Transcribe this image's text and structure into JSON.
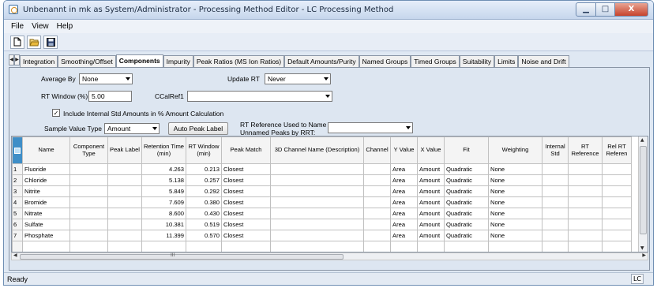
{
  "window": {
    "title": "Unbenannt in mk as System/Administrator - Processing Method Editor - LC Processing Method",
    "controls": {
      "minimize": "▁",
      "maximize": "□",
      "close": "X"
    }
  },
  "menu": [
    "File",
    "View",
    "Help"
  ],
  "toolbar": {
    "icons": [
      "new-icon",
      "open-icon",
      "save-icon"
    ]
  },
  "tabs": [
    {
      "label": "Integration",
      "active": false
    },
    {
      "label": "Smoothing/Offset",
      "active": false
    },
    {
      "label": "Components",
      "active": true
    },
    {
      "label": "Impurity",
      "active": false
    },
    {
      "label": "Peak Ratios (MS Ion Ratios)",
      "active": false
    },
    {
      "label": "Default Amounts/Purity",
      "active": false
    },
    {
      "label": "Named Groups",
      "active": false
    },
    {
      "label": "Timed Groups",
      "active": false
    },
    {
      "label": "Suitability",
      "active": false
    },
    {
      "label": "Limits",
      "active": false
    },
    {
      "label": "Noise and Drift",
      "active": false
    }
  ],
  "form": {
    "average_by_label": "Average By",
    "average_by_value": "None",
    "update_rt_label": "Update RT",
    "update_rt_value": "Never",
    "rt_window_label": "RT Window (%)",
    "rt_window_value": "5.00",
    "ccalref_label": "CCalRef1",
    "ccalref_value": "",
    "include_internal_label": "Include Internal Std Amounts in % Amount Calculation",
    "include_internal_checked": "✓",
    "sample_value_type_label": "Sample Value Type",
    "sample_value_type_value": "Amount",
    "auto_peak_label_button": "Auto Peak Label",
    "rt_reference_label_1": "RT Reference Used to Name",
    "rt_reference_label_2": "Unnamed Peaks by RRT:",
    "rt_reference_value": ""
  },
  "table": {
    "columns": [
      "Name",
      "Component Type",
      "Peak Label",
      "Retention Time (min)",
      "RT Window (min)",
      "Peak Match",
      "3D Channel Name (Description)",
      "Channel",
      "Y Value",
      "X Value",
      "Fit",
      "Weighting",
      "Internal Std",
      "RT Reference",
      "Rel RT Referen"
    ],
    "rows": [
      {
        "num": "1",
        "name": "Fluoride",
        "rt": "4.263",
        "rtw": "0.213",
        "match": "Closest",
        "y": "Area",
        "x": "Amount",
        "fit": "Quadratic",
        "weight": "None"
      },
      {
        "num": "2",
        "name": "Chloride",
        "rt": "5.138",
        "rtw": "0.257",
        "match": "Closest",
        "y": "Area",
        "x": "Amount",
        "fit": "Quadratic",
        "weight": "None"
      },
      {
        "num": "3",
        "name": "Nitrite",
        "rt": "5.849",
        "rtw": "0.292",
        "match": "Closest",
        "y": "Area",
        "x": "Amount",
        "fit": "Quadratic",
        "weight": "None"
      },
      {
        "num": "4",
        "name": "Bromide",
        "rt": "7.609",
        "rtw": "0.380",
        "match": "Closest",
        "y": "Area",
        "x": "Amount",
        "fit": "Quadratic",
        "weight": "None"
      },
      {
        "num": "5",
        "name": "Nitrate",
        "rt": "8.600",
        "rtw": "0.430",
        "match": "Closest",
        "y": "Area",
        "x": "Amount",
        "fit": "Quadratic",
        "weight": "None"
      },
      {
        "num": "6",
        "name": "Sulfate",
        "rt": "10.381",
        "rtw": "0.519",
        "match": "Closest",
        "y": "Area",
        "x": "Amount",
        "fit": "Quadratic",
        "weight": "None"
      },
      {
        "num": "7",
        "name": "Phosphate",
        "rt": "11.399",
        "rtw": "0.570",
        "match": "Closest",
        "y": "Area",
        "x": "Amount",
        "fit": "Quadratic",
        "weight": "None"
      }
    ]
  },
  "hscroll_grip": "III",
  "status": {
    "text": "Ready",
    "mode": "LC"
  }
}
